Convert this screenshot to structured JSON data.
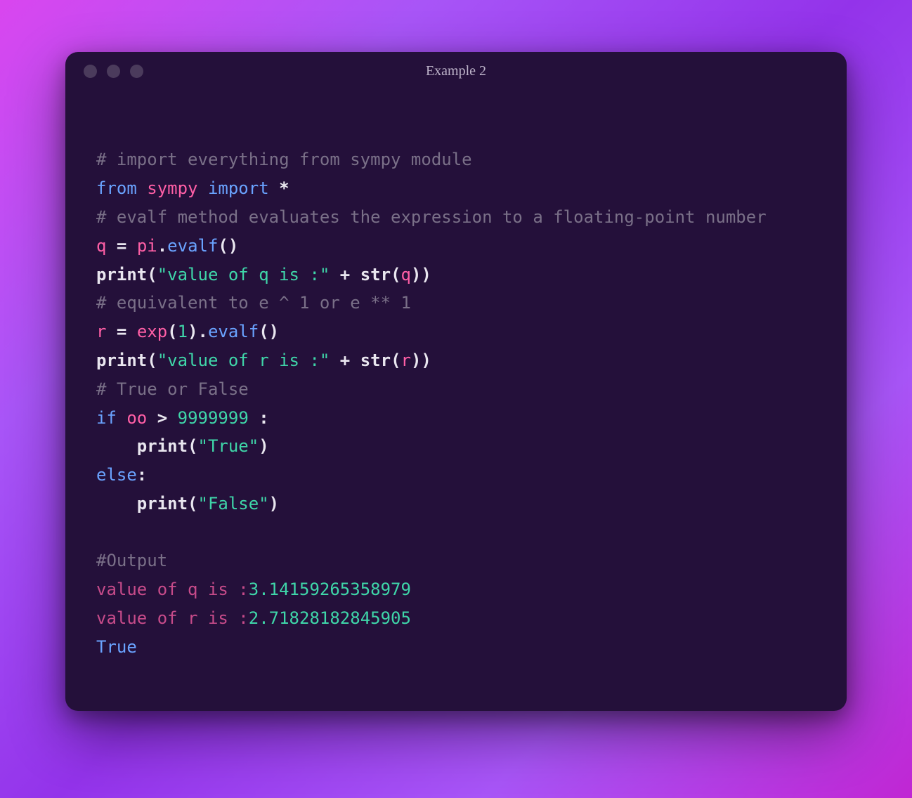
{
  "window": {
    "title": "Example 2"
  },
  "code": {
    "c1": "# import everything from sympy module",
    "kw_from": "from",
    "mod_sympy": "sympy",
    "kw_import": "import",
    "star": "*",
    "c2": "# evalf method evaluates the expression to a floating-point number",
    "var_q": "q",
    "eq": " = ",
    "pi": "pi",
    "dot": ".",
    "evalf": "evalf",
    "parens_empty": "()",
    "print": "print",
    "lparen": "(",
    "rparen": ")",
    "str_q": "\"value of q is :\"",
    "plus": " + ",
    "str_fn": "str",
    "c3": "# equivalent to e ^ 1 or e ** 1",
    "var_r": "r",
    "exp": "exp",
    "one": "1",
    "str_r": "\"value of r is :\"",
    "c4": "# True or False",
    "kw_if": "if",
    "oo": "oo",
    "gt": " > ",
    "bignum": "9999999",
    "colon": " :",
    "colon2": ":",
    "indent": "    ",
    "str_true": "\"True\"",
    "kw_else": "else",
    "str_false": "\"False\"",
    "c_out": "#Output",
    "out_q_lbl": "value of q is :",
    "out_q_val": "3.14159265358979",
    "out_r_lbl": "value of r is :",
    "out_r_val": "2.71828182845905",
    "out_true": "True"
  }
}
